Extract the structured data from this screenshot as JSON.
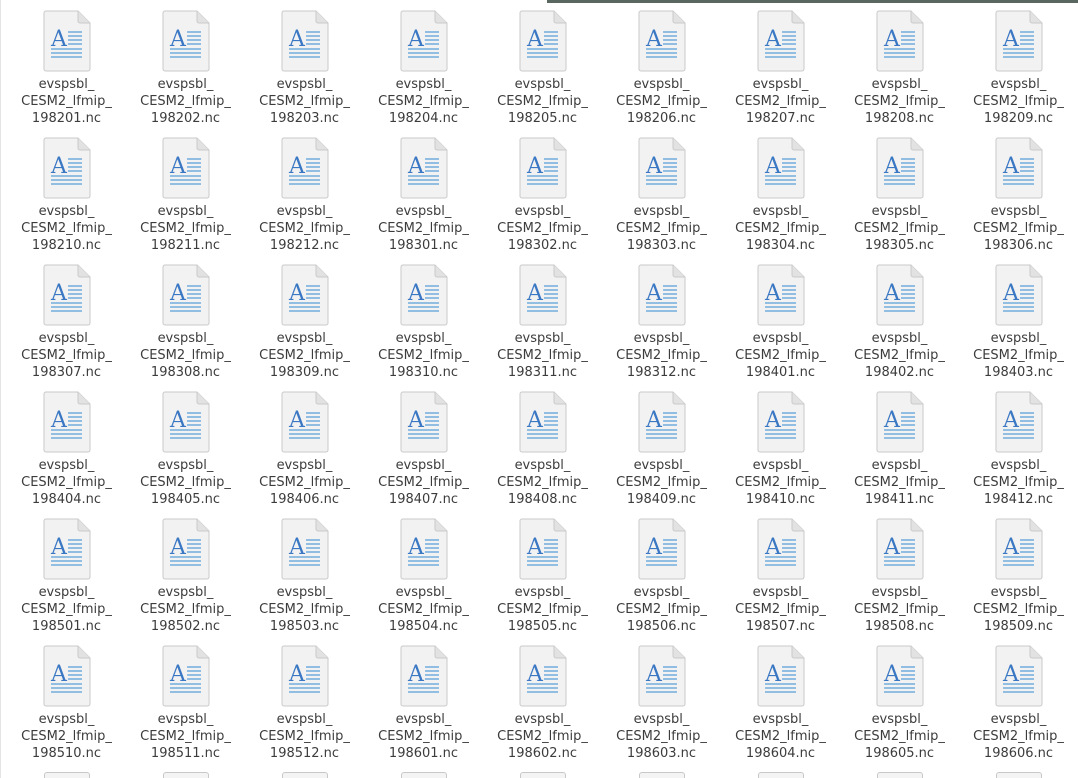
{
  "files": [
    {
      "line1": "evspsbl_",
      "line2": "CESM2_lfmip_",
      "line3": "198201.nc"
    },
    {
      "line1": "evspsbl_",
      "line2": "CESM2_lfmip_",
      "line3": "198202.nc"
    },
    {
      "line1": "evspsbl_",
      "line2": "CESM2_lfmip_",
      "line3": "198203.nc"
    },
    {
      "line1": "evspsbl_",
      "line2": "CESM2_lfmip_",
      "line3": "198204.nc"
    },
    {
      "line1": "evspsbl_",
      "line2": "CESM2_lfmip_",
      "line3": "198205.nc"
    },
    {
      "line1": "evspsbl_",
      "line2": "CESM2_lfmip_",
      "line3": "198206.nc"
    },
    {
      "line1": "evspsbl_",
      "line2": "CESM2_lfmip_",
      "line3": "198207.nc"
    },
    {
      "line1": "evspsbl_",
      "line2": "CESM2_lfmip_",
      "line3": "198208.nc"
    },
    {
      "line1": "evspsbl_",
      "line2": "CESM2_lfmip_",
      "line3": "198209.nc"
    },
    {
      "line1": "evspsbl_",
      "line2": "CESM2_lfmip_",
      "line3": "198210.nc"
    },
    {
      "line1": "evspsbl_",
      "line2": "CESM2_lfmip_",
      "line3": "198211.nc"
    },
    {
      "line1": "evspsbl_",
      "line2": "CESM2_lfmip_",
      "line3": "198212.nc"
    },
    {
      "line1": "evspsbl_",
      "line2": "CESM2_lfmip_",
      "line3": "198301.nc"
    },
    {
      "line1": "evspsbl_",
      "line2": "CESM2_lfmip_",
      "line3": "198302.nc"
    },
    {
      "line1": "evspsbl_",
      "line2": "CESM2_lfmip_",
      "line3": "198303.nc"
    },
    {
      "line1": "evspsbl_",
      "line2": "CESM2_lfmip_",
      "line3": "198304.nc"
    },
    {
      "line1": "evspsbl_",
      "line2": "CESM2_lfmip_",
      "line3": "198305.nc"
    },
    {
      "line1": "evspsbl_",
      "line2": "CESM2_lfmip_",
      "line3": "198306.nc"
    },
    {
      "line1": "evspsbl_",
      "line2": "CESM2_lfmip_",
      "line3": "198307.nc"
    },
    {
      "line1": "evspsbl_",
      "line2": "CESM2_lfmip_",
      "line3": "198308.nc"
    },
    {
      "line1": "evspsbl_",
      "line2": "CESM2_lfmip_",
      "line3": "198309.nc"
    },
    {
      "line1": "evspsbl_",
      "line2": "CESM2_lfmip_",
      "line3": "198310.nc"
    },
    {
      "line1": "evspsbl_",
      "line2": "CESM2_lfmip_",
      "line3": "198311.nc"
    },
    {
      "line1": "evspsbl_",
      "line2": "CESM2_lfmip_",
      "line3": "198312.nc"
    },
    {
      "line1": "evspsbl_",
      "line2": "CESM2_lfmip_",
      "line3": "198401.nc"
    },
    {
      "line1": "evspsbl_",
      "line2": "CESM2_lfmip_",
      "line3": "198402.nc"
    },
    {
      "line1": "evspsbl_",
      "line2": "CESM2_lfmip_",
      "line3": "198403.nc"
    },
    {
      "line1": "evspsbl_",
      "line2": "CESM2_lfmip_",
      "line3": "198404.nc"
    },
    {
      "line1": "evspsbl_",
      "line2": "CESM2_lfmip_",
      "line3": "198405.nc"
    },
    {
      "line1": "evspsbl_",
      "line2": "CESM2_lfmip_",
      "line3": "198406.nc"
    },
    {
      "line1": "evspsbl_",
      "line2": "CESM2_lfmip_",
      "line3": "198407.nc"
    },
    {
      "line1": "evspsbl_",
      "line2": "CESM2_lfmip_",
      "line3": "198408.nc"
    },
    {
      "line1": "evspsbl_",
      "line2": "CESM2_lfmip_",
      "line3": "198409.nc"
    },
    {
      "line1": "evspsbl_",
      "line2": "CESM2_lfmip_",
      "line3": "198410.nc"
    },
    {
      "line1": "evspsbl_",
      "line2": "CESM2_lfmip_",
      "line3": "198411.nc"
    },
    {
      "line1": "evspsbl_",
      "line2": "CESM2_lfmip_",
      "line3": "198412.nc"
    },
    {
      "line1": "evspsbl_",
      "line2": "CESM2_lfmip_",
      "line3": "198501.nc"
    },
    {
      "line1": "evspsbl_",
      "line2": "CESM2_lfmip_",
      "line3": "198502.nc"
    },
    {
      "line1": "evspsbl_",
      "line2": "CESM2_lfmip_",
      "line3": "198503.nc"
    },
    {
      "line1": "evspsbl_",
      "line2": "CESM2_lfmip_",
      "line3": "198504.nc"
    },
    {
      "line1": "evspsbl_",
      "line2": "CESM2_lfmip_",
      "line3": "198505.nc"
    },
    {
      "line1": "evspsbl_",
      "line2": "CESM2_lfmip_",
      "line3": "198506.nc"
    },
    {
      "line1": "evspsbl_",
      "line2": "CESM2_lfmip_",
      "line3": "198507.nc"
    },
    {
      "line1": "evspsbl_",
      "line2": "CESM2_lfmip_",
      "line3": "198508.nc"
    },
    {
      "line1": "evspsbl_",
      "line2": "CESM2_lfmip_",
      "line3": "198509.nc"
    },
    {
      "line1": "evspsbl_",
      "line2": "CESM2_lfmip_",
      "line3": "198510.nc"
    },
    {
      "line1": "evspsbl_",
      "line2": "CESM2_lfmip_",
      "line3": "198511.nc"
    },
    {
      "line1": "evspsbl_",
      "line2": "CESM2_lfmip_",
      "line3": "198512.nc"
    },
    {
      "line1": "evspsbl_",
      "line2": "CESM2_lfmip_",
      "line3": "198601.nc"
    },
    {
      "line1": "evspsbl_",
      "line2": "CESM2_lfmip_",
      "line3": "198602.nc"
    },
    {
      "line1": "evspsbl_",
      "line2": "CESM2_lfmip_",
      "line3": "198603.nc"
    },
    {
      "line1": "evspsbl_",
      "line2": "CESM2_lfmip_",
      "line3": "198604.nc"
    },
    {
      "line1": "evspsbl_",
      "line2": "CESM2_lfmip_",
      "line3": "198605.nc"
    },
    {
      "line1": "evspsbl_",
      "line2": "CESM2_lfmip_",
      "line3": "198606.nc"
    }
  ],
  "icon": {
    "name": "text-document-icon",
    "glyph": "A",
    "glyph_color": "#3b78c4",
    "line_color": "#5aa0d8",
    "page_color": "#f2f2f2",
    "page_border": "#c9c9c9"
  },
  "text_color": "#3c3c3c"
}
